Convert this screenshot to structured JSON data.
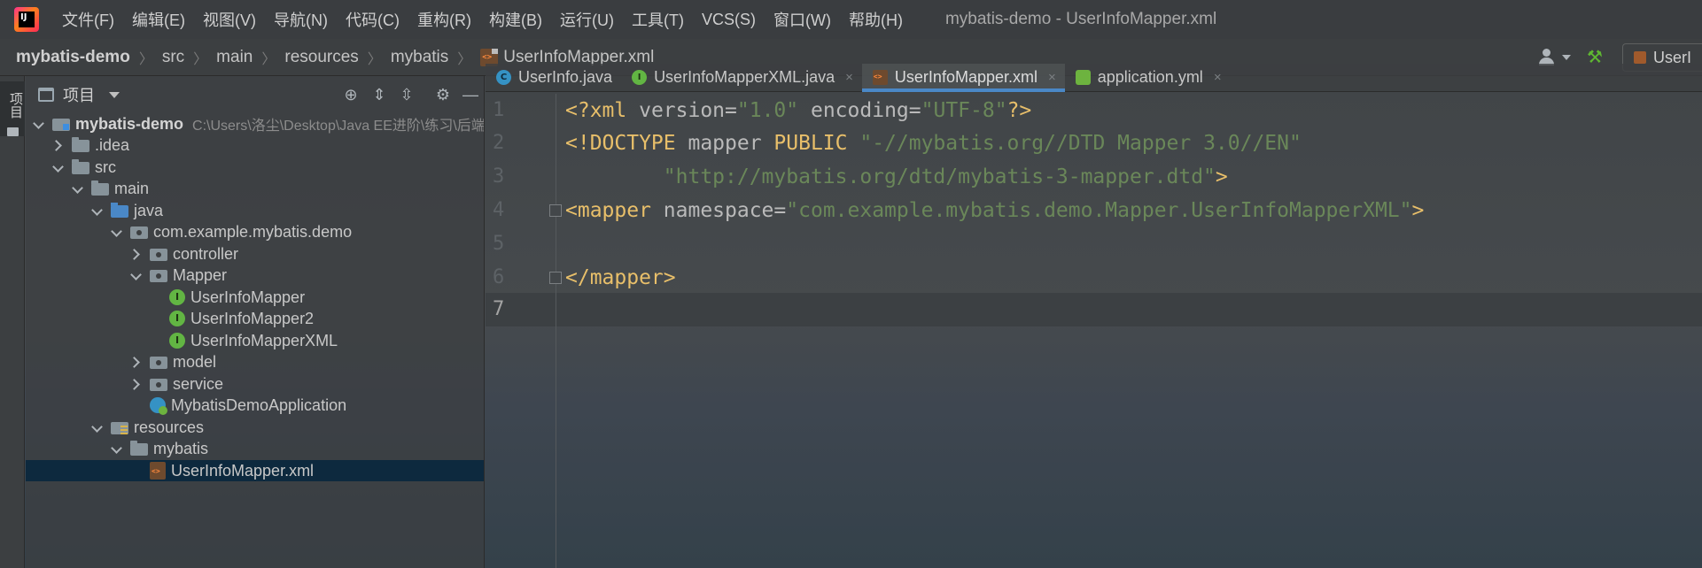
{
  "menu": {
    "items": [
      "文件(F)",
      "编辑(E)",
      "视图(V)",
      "导航(N)",
      "代码(C)",
      "重构(R)",
      "构建(B)",
      "运行(U)",
      "工具(T)",
      "VCS(S)",
      "窗口(W)",
      "帮助(H)"
    ],
    "window_title": "mybatis-demo - UserInfoMapper.xml"
  },
  "breadcrumb": {
    "items": [
      "mybatis-demo",
      "src",
      "main",
      "resources",
      "mybatis"
    ],
    "file": "UserInfoMapper.xml"
  },
  "toolbar": {
    "run_config": "UserI"
  },
  "toolstrip": {
    "project_tab": "项目"
  },
  "project_panel": {
    "title": "项目",
    "tree": [
      {
        "label": "mybatis-demo",
        "path": "C:\\Users\\洛尘\\Desktop\\Java EE进阶\\练习\\后端代码\\r"
      },
      {
        "label": ".idea"
      },
      {
        "label": "src"
      },
      {
        "label": "main"
      },
      {
        "label": "java"
      },
      {
        "label": "com.example.mybatis.demo"
      },
      {
        "label": "controller"
      },
      {
        "label": "Mapper"
      },
      {
        "label": "UserInfoMapper"
      },
      {
        "label": "UserInfoMapper2"
      },
      {
        "label": "UserInfoMapperXML"
      },
      {
        "label": "model"
      },
      {
        "label": "service"
      },
      {
        "label": "MybatisDemoApplication"
      },
      {
        "label": "resources"
      },
      {
        "label": "mybatis"
      },
      {
        "label": "UserInfoMapper.xml"
      }
    ]
  },
  "editor": {
    "tabs": [
      {
        "label": "UserInfo.java",
        "icon_letter": "C"
      },
      {
        "label": "UserInfoMapperXML.java",
        "icon_letter": "I"
      },
      {
        "label": "UserInfoMapper.xml",
        "icon_letter": ""
      },
      {
        "label": "application.yml",
        "icon_letter": ""
      }
    ],
    "close_glyph": "×",
    "line_numbers": [
      "1",
      "2",
      "3",
      "4",
      "5",
      "6",
      "7"
    ],
    "code": {
      "l1": {
        "open": "<?xml",
        "a1": " version",
        "eq1": "=",
        "v1": "\"1.0\"",
        "a2": " encoding",
        "eq2": "=",
        "v2": "\"UTF-8\"",
        "close": "?>"
      },
      "l2": {
        "open": "<!DOCTYPE",
        "a1": " mapper",
        "kw": " PUBLIC",
        "v1": " \"-//mybatis.org//DTD Mapper 3.0//EN\""
      },
      "l3": {
        "indent": "        ",
        "v1": "\"http://mybatis.org/dtd/mybatis-3-mapper.dtd\"",
        "close": ">"
      },
      "l4": {
        "open": "<mapper",
        "a1": " namespace",
        "eq1": "=",
        "v1": "\"com.example.mybatis.demo.Mapper.UserInfoMapperXML\"",
        "close": ">"
      },
      "l6": {
        "tag": "</mapper>"
      }
    }
  },
  "colors": {
    "tag": "#e8bf6a",
    "string": "#6a8759",
    "attribute": "#bababa",
    "selection": "#0d293e",
    "active_tab_underline": "#4a88c7"
  }
}
